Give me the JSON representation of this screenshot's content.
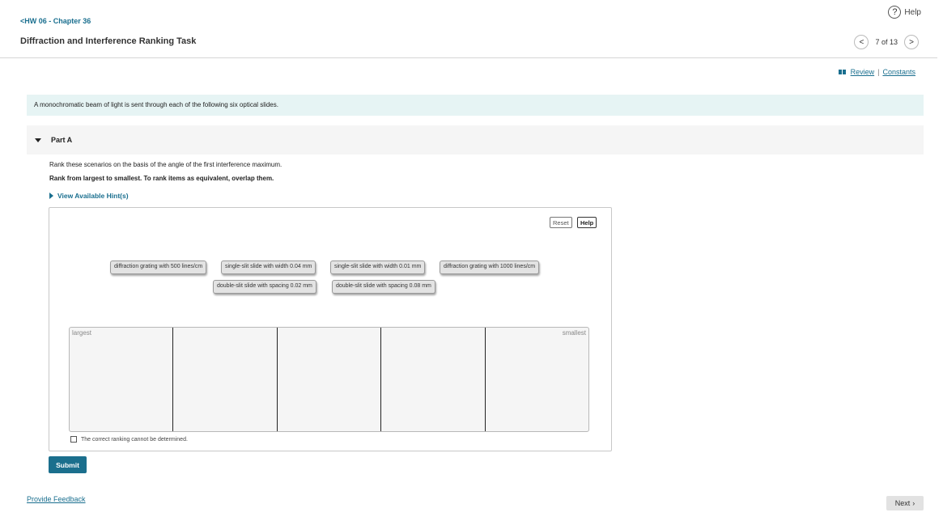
{
  "header": {
    "help_label": "Help",
    "help_icon": "?",
    "breadcrumb": "HW 06 - Chapter 36",
    "breadcrumb_icon": "<",
    "title": "Diffraction and Interference Ranking Task",
    "pager_text": "7 of 13",
    "prev_icon": "<",
    "next_icon": ">"
  },
  "links": {
    "review": "Review",
    "separator": "|",
    "constants": "Constants"
  },
  "intro": "A monochromatic beam of light is sent through each of the following six optical slides.",
  "part": {
    "label": "Part A",
    "question": "Rank these scenarios on the basis of the angle of the first interference maximum.",
    "instruction": "Rank from largest to smallest. To rank items as equivalent, overlap them.",
    "hints": "View Available Hint(s)"
  },
  "ranking": {
    "reset_label": "Reset",
    "help_label": "Help",
    "items": [
      "diffraction grating with 500 lines/cm",
      "single-slit slide with width 0.04 mm",
      "single-slit slide with width 0.01 mm",
      "diffraction grating with 1000 lines/cm",
      "double-slit slide with spacing 0.02 mm",
      "double-slit slide with spacing 0.08 mm"
    ],
    "largest_label": "largest",
    "smallest_label": "smallest",
    "cannot_determine": "The correct ranking cannot be determined."
  },
  "footer": {
    "submit": "Submit",
    "feedback": "Provide Feedback",
    "next": "Next",
    "next_icon": "›"
  },
  "colors": {
    "accent": "#1b6f8d",
    "intro_bg": "#e6f4f4",
    "part_bg": "#f5f5f5"
  }
}
